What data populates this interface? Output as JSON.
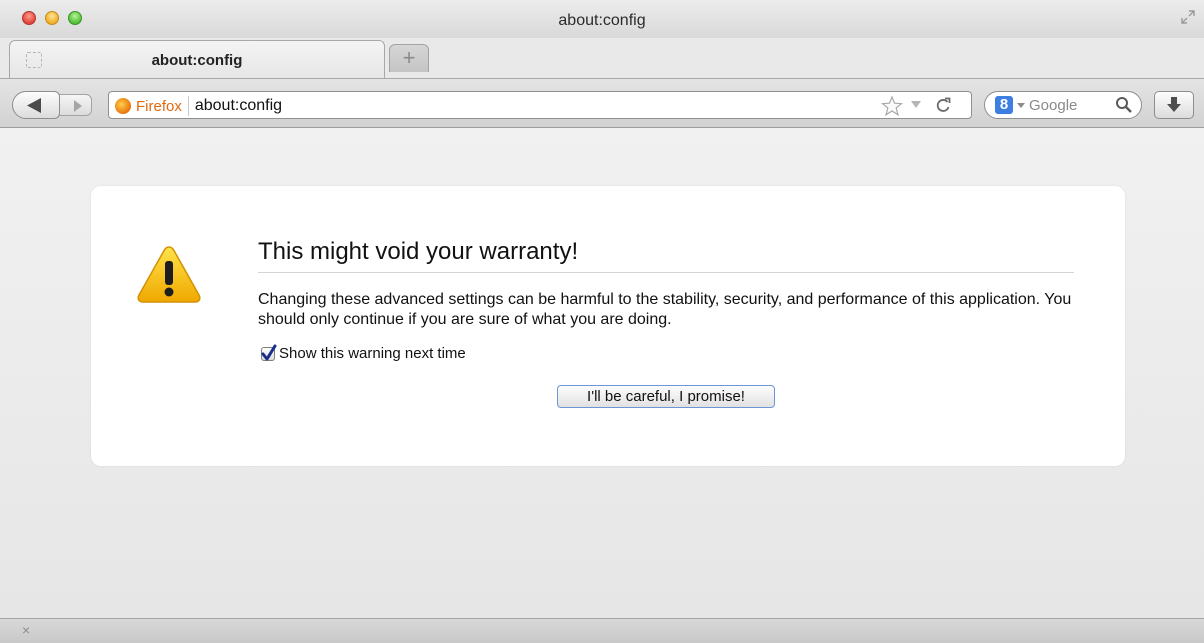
{
  "window": {
    "title": "about:config"
  },
  "tab": {
    "label": "about:config",
    "new_tab_label": "+"
  },
  "urlbar": {
    "identity_label": "Firefox",
    "url": "about:config"
  },
  "searchbar": {
    "engine_letter": "8",
    "placeholder": "Google"
  },
  "warning": {
    "title": "This might void your warranty!",
    "body": "Changing these advanced settings can be harmful to the stability, security, and performance of this application. You should only continue if you are sure of what you are doing.",
    "checkbox_label": "Show this warning next time",
    "checkbox_checked": true,
    "button_label": "I'll be careful, I promise!"
  },
  "statusbar": {
    "close_glyph": "×"
  },
  "colors": {
    "identity_accent": "#e06a10",
    "button_focus": "#6d96d6",
    "warning_yellow": "#f5c400"
  },
  "icons": [
    "fullscreen-icon",
    "back-arrow-icon",
    "forward-arrow-icon",
    "firefox-icon",
    "star-icon",
    "dropmarker-icon",
    "reload-icon",
    "search-icon",
    "download-icon",
    "warning-icon",
    "checkmark-icon"
  ]
}
